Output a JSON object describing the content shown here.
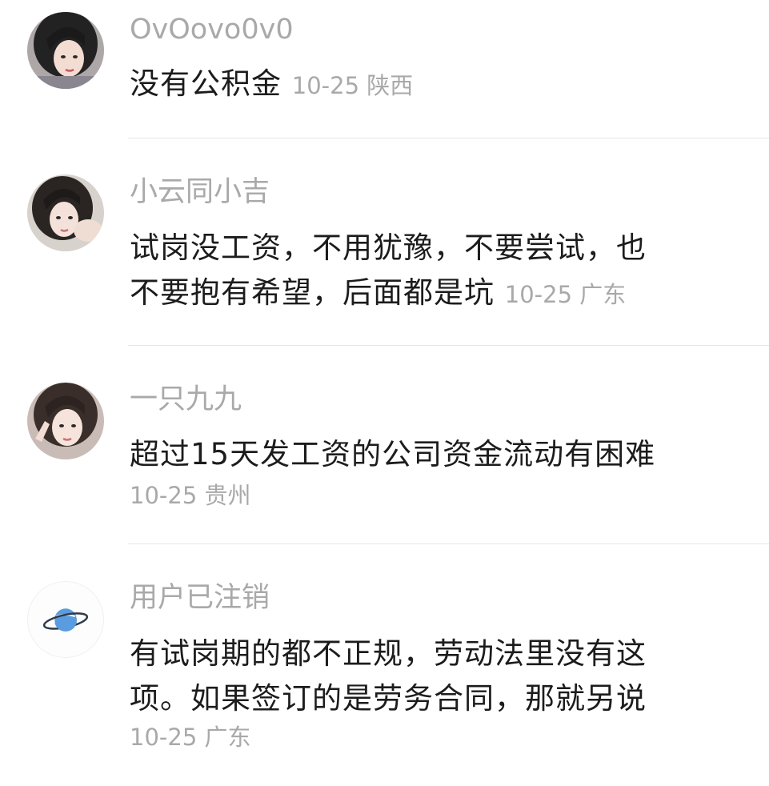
{
  "comments": [
    {
      "username": "OvOovo0v0",
      "text": "没有公积金",
      "date": "10-25",
      "location": "陕西",
      "avatar": "girl-photo-avatar"
    },
    {
      "username": "小云同小吉",
      "text_line1": "试岗没工资，不用犹豫，不要尝试，也",
      "text_line2": "不要抱有希望，后面都是坑",
      "date": "10-25",
      "location": "广东",
      "avatar": "girl-photo-avatar"
    },
    {
      "username": "一只九九",
      "text": "超过15天发工资的公司资金流动有困难",
      "date": "10-25",
      "location": "贵州",
      "avatar": "girl-photo-avatar"
    },
    {
      "username": "用户已注销",
      "text_line1": "有试岗期的都不正规，劳动法里没有这",
      "text_line2": "项。如果签订的是劳务合同，那就另说",
      "date": "10-25",
      "location": "广东",
      "avatar": "planet-icon"
    }
  ],
  "colors": {
    "username": "#a9a9a9",
    "text": "#1c1c1c",
    "meta": "#a9a9a9",
    "divider": "#e6e6e6",
    "planet": "#4a90d9"
  }
}
